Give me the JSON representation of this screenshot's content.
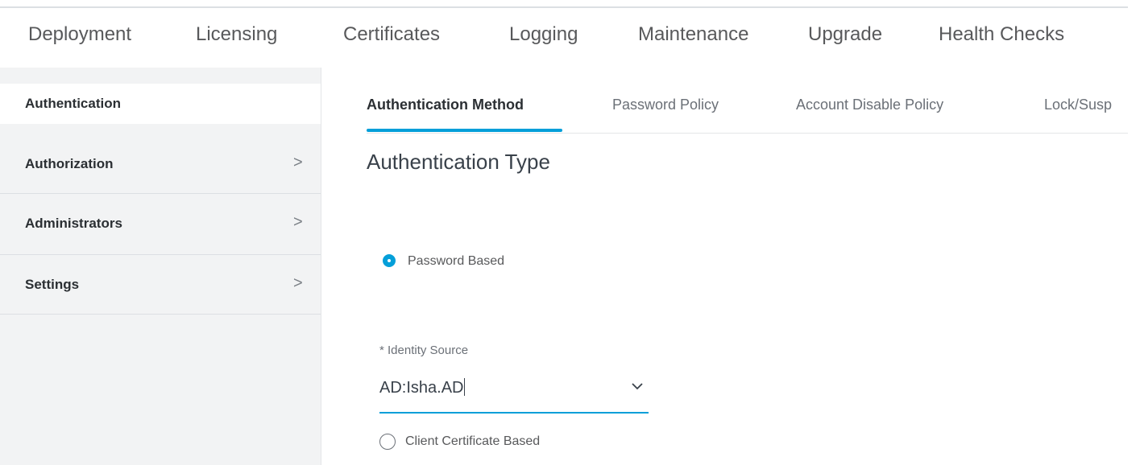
{
  "top_nav": {
    "tabs": [
      "Deployment",
      "Licensing",
      "Certificates",
      "Logging",
      "Maintenance",
      "Upgrade",
      "Health Checks"
    ]
  },
  "sidebar": {
    "items": [
      {
        "label": "Authentication",
        "active": true,
        "has_chevron": false
      },
      {
        "label": "Authorization",
        "active": false,
        "has_chevron": true
      },
      {
        "label": "Administrators",
        "active": false,
        "has_chevron": true
      },
      {
        "label": "Settings",
        "active": false,
        "has_chevron": true
      }
    ],
    "chevron_glyph": ">"
  },
  "sub_tabs": {
    "tabs": [
      "Authentication Method",
      "Password Policy",
      "Account Disable Policy",
      "Lock/Susp"
    ],
    "active_index": 0
  },
  "main": {
    "section_title": "Authentication Type",
    "password_based": {
      "label": "Password Based",
      "checked": true
    },
    "identity_source": {
      "label": "* Identity Source",
      "value": "AD:Isha.AD"
    },
    "client_certificate_based": {
      "label": "Client Certificate Based",
      "checked": false
    }
  },
  "colors": {
    "accent": "#049fd9",
    "sidebar_bg": "#f2f3f4",
    "text_dark": "#2b2f33"
  }
}
